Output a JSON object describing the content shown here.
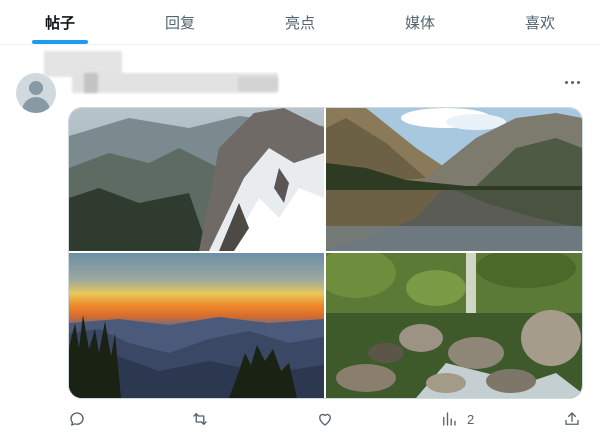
{
  "tabs": [
    {
      "label": "帖子",
      "active": true
    },
    {
      "label": "回复",
      "active": false
    },
    {
      "label": "亮点",
      "active": false
    },
    {
      "label": "媒体",
      "active": false
    },
    {
      "label": "喜欢",
      "active": false
    }
  ],
  "post": {
    "more_icon": "more-horizontal-icon",
    "photos": [
      "snowy-mountain-slope",
      "lake-reflection-valley",
      "sunset-ridge-silhouette",
      "forest-stream-rocks"
    ],
    "actions": {
      "reply_icon": "reply-icon",
      "repost_icon": "repost-icon",
      "like_icon": "heart-icon",
      "views_icon": "analytics-icon",
      "views_count": "2",
      "share_icon": "share-icon"
    }
  },
  "colors": {
    "accent": "#1d9bf0",
    "muted": "#536471",
    "border": "#eff3f4"
  }
}
